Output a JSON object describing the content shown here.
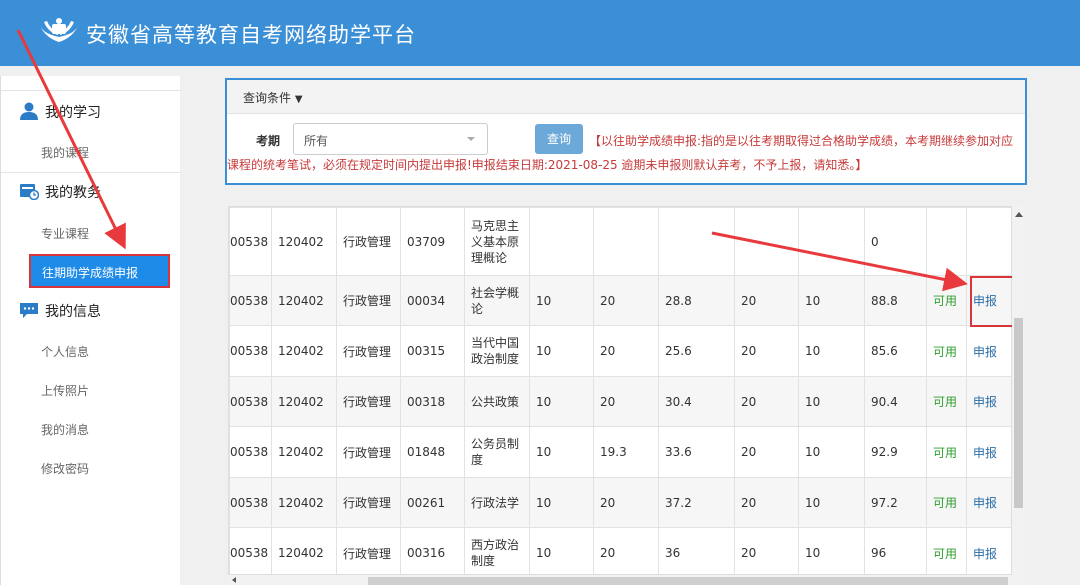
{
  "header": {
    "title": "安徽省高等教育自考网络助学平台",
    "logo_icon": "hands-badge-icon"
  },
  "sidebar": {
    "sections": [
      {
        "label": "我的学习",
        "icon": "user-icon"
      },
      {
        "label": "我的教务",
        "icon": "calendar-clock-icon"
      },
      {
        "label": "我的信息",
        "icon": "chat-bubble-icon"
      }
    ],
    "items": {
      "study_courses": "我的课程",
      "major_courses": "专业课程",
      "past_score_apply": "往期助学成绩申报",
      "personal_info": "个人信息",
      "upload_photo": "上传照片",
      "my_messages": "我的消息",
      "change_password": "修改密码"
    }
  },
  "query": {
    "panel_title": "查询条件",
    "term_label": "考期",
    "term_value": "所有",
    "search_button": "查询",
    "notice_line1": "【以往助学成绩申报:指的是以往考期取得过合格助学成绩，本考期继续参加对应",
    "notice_line2": "课程的统考笔试，必须在规定时间内提出申报!申报结束日期:2021-08-25 逾期未申报则默认弃考，不予上报，请知悉。】"
  },
  "table": {
    "rows": [
      {
        "c1": "00538",
        "c2": "120402",
        "c3": "行政管理",
        "c4": "03709",
        "name": "马克思主义基本原理概论",
        "s1": "",
        "s2": "",
        "s3": "",
        "s4": "",
        "s5": "",
        "total": "0",
        "status": "",
        "action": ""
      },
      {
        "c1": "00538",
        "c2": "120402",
        "c3": "行政管理",
        "c4": "00034",
        "name": "社会学概论",
        "s1": "10",
        "s2": "20",
        "s3": "28.8",
        "s4": "20",
        "s5": "10",
        "total": "88.8",
        "status": "可用",
        "action": "申报"
      },
      {
        "c1": "00538",
        "c2": "120402",
        "c3": "行政管理",
        "c4": "00315",
        "name": "当代中国政治制度",
        "s1": "10",
        "s2": "20",
        "s3": "25.6",
        "s4": "20",
        "s5": "10",
        "total": "85.6",
        "status": "可用",
        "action": "申报"
      },
      {
        "c1": "00538",
        "c2": "120402",
        "c3": "行政管理",
        "c4": "00318",
        "name": "公共政策",
        "s1": "10",
        "s2": "20",
        "s3": "30.4",
        "s4": "20",
        "s5": "10",
        "total": "90.4",
        "status": "可用",
        "action": "申报"
      },
      {
        "c1": "00538",
        "c2": "120402",
        "c3": "行政管理",
        "c4": "01848",
        "name": "公务员制度",
        "s1": "10",
        "s2": "19.3",
        "s3": "33.6",
        "s4": "20",
        "s5": "10",
        "total": "92.9",
        "status": "可用",
        "action": "申报"
      },
      {
        "c1": "00538",
        "c2": "120402",
        "c3": "行政管理",
        "c4": "00261",
        "name": "行政法学",
        "s1": "10",
        "s2": "20",
        "s3": "37.2",
        "s4": "20",
        "s5": "10",
        "total": "97.2",
        "status": "可用",
        "action": "申报"
      },
      {
        "c1": "00538",
        "c2": "120402",
        "c3": "行政管理",
        "c4": "00316",
        "name": "西方政治制度",
        "s1": "10",
        "s2": "20",
        "s3": "36",
        "s4": "20",
        "s5": "10",
        "total": "96",
        "status": "可用",
        "action": "申报"
      }
    ]
  },
  "colors": {
    "header_bg": "#3b8fd6",
    "active_nav": "#1f8be8",
    "highlight_red": "#d9343a",
    "status_green": "#2e9e2e",
    "link_blue": "#2c6fa8",
    "notice_red": "#c73a3a"
  }
}
